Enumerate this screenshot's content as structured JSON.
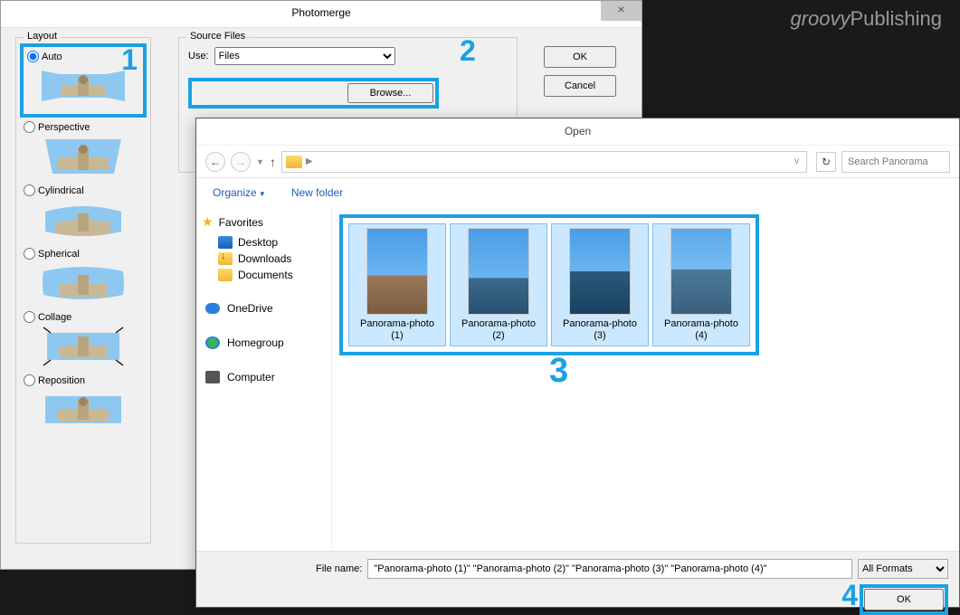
{
  "watermark": {
    "groovy": "groovy",
    "pub": "Publishing"
  },
  "pm": {
    "title": "Photomerge",
    "layout_label": "Layout",
    "options": {
      "auto": "Auto",
      "perspective": "Perspective",
      "cylindrical": "Cylindrical",
      "spherical": "Spherical",
      "collage": "Collage",
      "reposition": "Reposition"
    },
    "source_label": "Source Files",
    "use_label": "Use:",
    "use_value": "Files",
    "browse": "Browse...",
    "ok": "OK",
    "cancel": "Cancel"
  },
  "open": {
    "title": "Open",
    "search_placeholder": "Search Panorama",
    "organize": "Organize",
    "new_folder": "New folder",
    "favorites": "Favorites",
    "desktop": "Desktop",
    "downloads": "Downloads",
    "documents": "Documents",
    "onedrive": "OneDrive",
    "homegroup": "Homegroup",
    "computer": "Computer",
    "files": [
      {
        "name": "Panorama-photo (1)"
      },
      {
        "name": "Panorama-photo (2)"
      },
      {
        "name": "Panorama-photo (3)"
      },
      {
        "name": "Panorama-photo (4)"
      }
    ],
    "filename_label": "File name:",
    "filename_value": "\"Panorama-photo (1)\" \"Panorama-photo (2)\" \"Panorama-photo (3)\" \"Panorama-photo (4)\"",
    "format": "All Formats",
    "ok": "OK"
  },
  "annotations": {
    "one": "1",
    "two": "2",
    "three": "3",
    "four": "4"
  }
}
